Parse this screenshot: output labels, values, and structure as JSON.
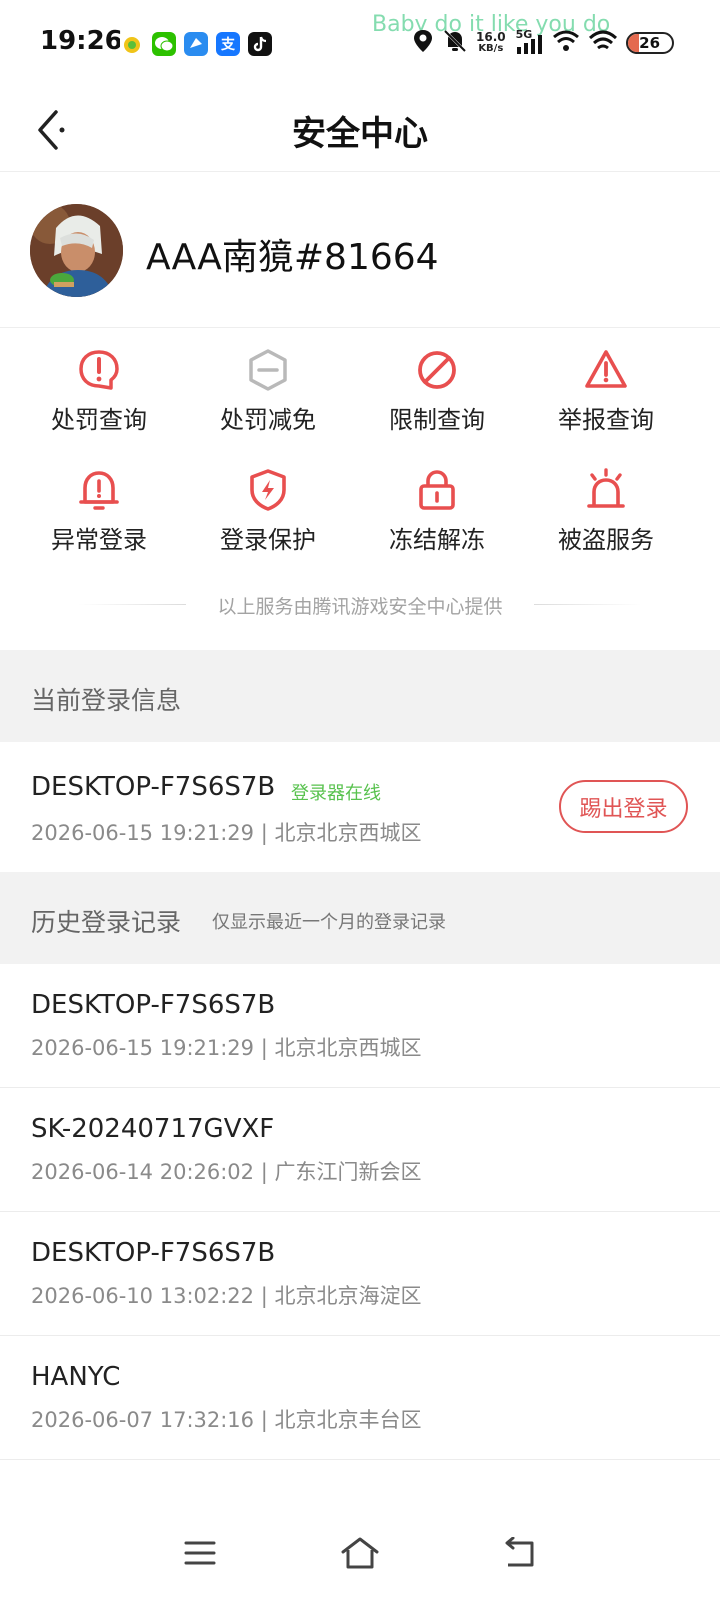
{
  "status_bar": {
    "time": "19:26",
    "lyric": "Baby do it like you do",
    "net_speed": "16.0",
    "net_unit": "KB/s",
    "network": "5G",
    "battery": "26",
    "battery_level": 0.26,
    "apps": [
      "candy-app-icon",
      "wechat-icon",
      "browser-icon",
      "alipay-icon",
      "tiktok-icon"
    ],
    "status_icons": [
      "location-icon",
      "mute-bell-icon",
      "signal-icon",
      "wifi-icon"
    ]
  },
  "header": {
    "title": "安全中心",
    "back_icon": "back-arrow-icon"
  },
  "profile": {
    "username": "AAA南獍#81664"
  },
  "services": [
    {
      "label": "处罚查询",
      "icon": "penalty-query-icon",
      "color": "#e84f4f"
    },
    {
      "label": "处罚减免",
      "icon": "penalty-relief-icon",
      "color": "#b9b9b9"
    },
    {
      "label": "限制查询",
      "icon": "restriction-query-icon",
      "color": "#e84f4f"
    },
    {
      "label": "举报查询",
      "icon": "report-query-icon",
      "color": "#e84f4f"
    },
    {
      "label": "异常登录",
      "icon": "abnormal-login-icon",
      "color": "#e84f4f"
    },
    {
      "label": "登录保护",
      "icon": "login-protect-icon",
      "color": "#e84f4f"
    },
    {
      "label": "冻结解冻",
      "icon": "freeze-icon",
      "color": "#e84f4f"
    },
    {
      "label": "被盗服务",
      "icon": "theft-alarm-icon",
      "color": "#e84f4f"
    }
  ],
  "provider_note": "以上服务由腾讯游戏安全中心提供",
  "current_login": {
    "section_title": "当前登录信息",
    "device": "DESKTOP-F7S6S7B",
    "status_tag": "登录器在线",
    "meta": "2026-06-15 19:21:29 | 北京北京西城区",
    "kick_label": "踢出登录"
  },
  "history": {
    "section_title": "历史登录记录",
    "section_note": "仅显示最近一个月的登录记录",
    "records": [
      {
        "device": "DESKTOP-F7S6S7B",
        "meta": "2026-06-15 19:21:29 | 北京北京西城区"
      },
      {
        "device": "SK-20240717GVXF",
        "meta": "2026-06-14 20:26:02 | 广东江门新会区"
      },
      {
        "device": "DESKTOP-F7S6S7B",
        "meta": "2026-06-10 13:02:22 | 北京北京海淀区"
      },
      {
        "device": "HANYC",
        "meta": "2026-06-07 17:32:16 | 北京北京丰台区"
      }
    ]
  },
  "navbar": {
    "icons": [
      "menu-icon",
      "home-icon",
      "back-nav-icon"
    ]
  },
  "colors": {
    "accent_red": "#e84f4f",
    "online_green": "#58c24e",
    "section_bg": "#f2f2f2"
  }
}
